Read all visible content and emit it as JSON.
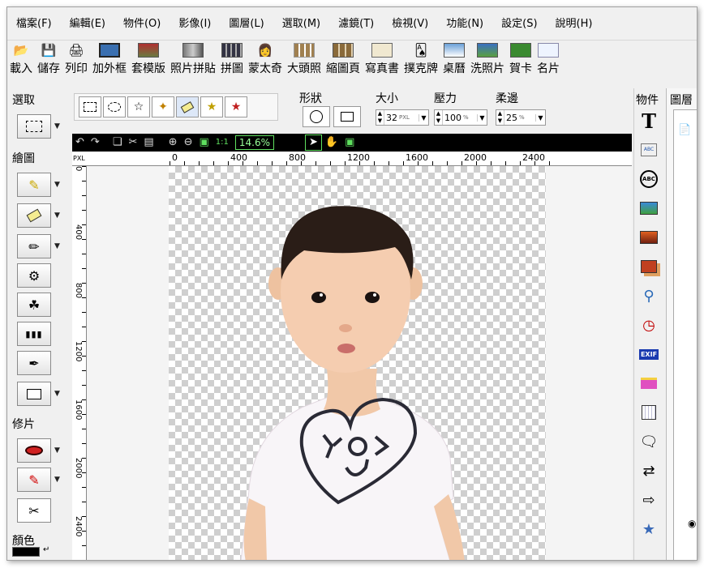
{
  "menu": [
    "檔案(F)",
    "編輯(E)",
    "物件(O)",
    "影像(I)",
    "圖層(L)",
    "選取(M)",
    "濾鏡(T)",
    "檢視(V)",
    "功能(N)",
    "設定(S)",
    "說明(H)"
  ],
  "toolbar": [
    {
      "label": "載入",
      "icon": "open-folder-icon"
    },
    {
      "label": "儲存",
      "icon": "floppy-icon"
    },
    {
      "label": "列印",
      "icon": "printer-icon"
    },
    {
      "label": "加外框",
      "icon": "frame-icon"
    },
    {
      "label": "套模版",
      "icon": "template-icon"
    },
    {
      "label": "照片拼貼",
      "icon": "collage-icon"
    },
    {
      "label": "拼圖",
      "icon": "puzzle-icon"
    },
    {
      "label": "蒙太奇",
      "icon": "montage-icon"
    },
    {
      "label": "大頭照",
      "icon": "id-photo-icon"
    },
    {
      "label": "縮圖頁",
      "icon": "thumbnail-icon"
    },
    {
      "label": "寫真書",
      "icon": "photobook-icon"
    },
    {
      "label": "撲克牌",
      "icon": "poker-icon"
    },
    {
      "label": "桌曆",
      "icon": "calendar-icon"
    },
    {
      "label": "洗照片",
      "icon": "print-photo-icon"
    },
    {
      "label": "賀卡",
      "icon": "greeting-card-icon"
    },
    {
      "label": "名片",
      "icon": "business-card-icon"
    }
  ],
  "left": {
    "select_label": "選取",
    "draw_label": "繪圖",
    "retouch_label": "修片",
    "color_label": "顏色"
  },
  "options": {
    "shape_label": "形狀",
    "size_label": "大小",
    "pressure_label": "壓力",
    "soft_label": "柔邊",
    "size_value": "32",
    "size_unit": "PXL",
    "pressure_value": "100",
    "pressure_unit": "%",
    "soft_value": "25",
    "soft_unit": "%"
  },
  "image_toolbar": {
    "zoom": "14.6%"
  },
  "ruler": {
    "unit": "PXL",
    "top": [
      "0",
      "400",
      "800",
      "1200",
      "1600",
      "2000",
      "2400"
    ],
    "left": [
      "0",
      "400",
      "800",
      "1200",
      "1600",
      "2000",
      "2400"
    ]
  },
  "right_label": "物件",
  "right_panel_label": "圖層"
}
